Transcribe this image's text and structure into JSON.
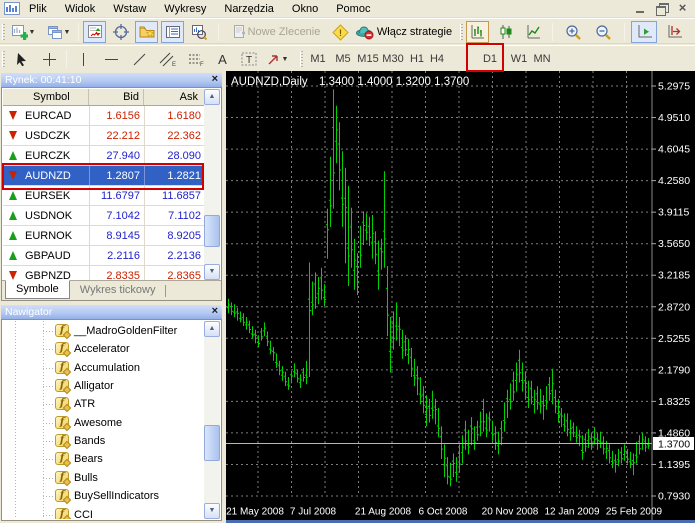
{
  "menu": {
    "items": [
      "Plik",
      "Widok",
      "Wstaw",
      "Wykresy",
      "Narzędzia",
      "Okno",
      "Pomoc"
    ]
  },
  "toolbar": {
    "new_order_label": "Nowe Zlecenie",
    "experts_label": "Włącz strategie",
    "periods": [
      "M1",
      "M5",
      "M15",
      "M30",
      "H1",
      "H4",
      "D1",
      "W1",
      "MN"
    ],
    "highlighted_period": "D1"
  },
  "market_watch": {
    "title": "Rynek: 00:41:10",
    "columns": [
      "Symbol",
      "Bid",
      "Ask"
    ],
    "rows": [
      {
        "symbol": "EURCAD",
        "bid": "1.6156",
        "ask": "1.6180",
        "direction": "down"
      },
      {
        "symbol": "USDCZK",
        "bid": "22.212",
        "ask": "22.362",
        "direction": "down"
      },
      {
        "symbol": "EURCZK",
        "bid": "27.940",
        "ask": "28.090",
        "direction": "up"
      },
      {
        "symbol": "AUDNZD",
        "bid": "1.2807",
        "ask": "1.2821",
        "direction": "down",
        "selected": true
      },
      {
        "symbol": "EURSEK",
        "bid": "11.6797",
        "ask": "11.6857",
        "direction": "up"
      },
      {
        "symbol": "USDNOK",
        "bid": "7.1042",
        "ask": "7.1102",
        "direction": "up"
      },
      {
        "symbol": "EURNOK",
        "bid": "8.9145",
        "ask": "8.9205",
        "direction": "up"
      },
      {
        "symbol": "GBPAUD",
        "bid": "2.2116",
        "ask": "2.2136",
        "direction": "up"
      },
      {
        "symbol": "GBPNZD",
        "bid": "2.8335",
        "ask": "2.8365",
        "direction": "down"
      }
    ],
    "tabs": [
      {
        "label": "Symbole",
        "active": true
      },
      {
        "label": "Wykres tickowy",
        "active": false
      }
    ]
  },
  "navigator": {
    "title": "Nawigator",
    "items": [
      "__MadroGoldenFilter",
      "Accelerator",
      "Accumulation",
      "Alligator",
      "ATR",
      "Awesome",
      "Bands",
      "Bears",
      "Bulls",
      "BuySellIndicators",
      "CCI"
    ]
  },
  "chart_data": {
    "type": "bar",
    "title": "AUDNZD,Daily",
    "ohlc_text": "1.3400 1.4000 1.3200 1.3700",
    "open": 1.34,
    "high": 1.4,
    "low": 1.32,
    "close": 1.37,
    "current_price": 1.37,
    "current_price_label": "1.3700",
    "price_ticks": [
      5.2975,
      4.951,
      4.6045,
      4.258,
      3.9115,
      3.565,
      3.2185,
      2.872,
      2.5255,
      2.179,
      1.8325,
      1.486,
      1.1395,
      0.793
    ],
    "x_ticks": [
      "21 May 2008",
      "7 Jul 2008",
      "21 Aug 2008",
      "6 Oct 2008",
      "20 Nov 2008",
      "12 Jan 2009",
      "25 Feb 2009"
    ],
    "ylim": [
      0.72,
      5.45
    ],
    "grid": true,
    "bar_color": "#00d200",
    "background": "#000000",
    "bars_low_high": [
      [
        2.8,
        2.96
      ],
      [
        2.78,
        2.92
      ],
      [
        2.76,
        2.9
      ],
      [
        2.72,
        2.86
      ],
      [
        2.7,
        2.82
      ],
      [
        2.66,
        2.8
      ],
      [
        2.62,
        2.76
      ],
      [
        2.58,
        2.72
      ],
      [
        2.52,
        2.66
      ],
      [
        2.47,
        2.62
      ],
      [
        2.43,
        2.56
      ],
      [
        2.5,
        2.64
      ],
      [
        2.55,
        2.7
      ],
      [
        2.44,
        2.6
      ],
      [
        2.35,
        2.5
      ],
      [
        2.28,
        2.43
      ],
      [
        2.2,
        2.36
      ],
      [
        2.12,
        2.28
      ],
      [
        2.06,
        2.22
      ],
      [
        2.0,
        2.16
      ],
      [
        1.96,
        2.1
      ],
      [
        2.03,
        2.17
      ],
      [
        2.1,
        2.25
      ],
      [
        2.04,
        2.18
      ],
      [
        1.98,
        2.13
      ],
      [
        2.05,
        2.2
      ],
      [
        2.02,
        2.28
      ],
      [
        2.1,
        3.36
      ],
      [
        2.78,
        3.15
      ],
      [
        2.85,
        3.25
      ],
      [
        2.9,
        3.2
      ],
      [
        2.95,
        3.3
      ],
      [
        2.88,
        3.12
      ],
      [
        3.4,
        3.95
      ],
      [
        3.75,
        4.52
      ],
      [
        3.95,
        5.26
      ],
      [
        4.45,
        5.08
      ],
      [
        4.15,
        4.9
      ],
      [
        3.75,
        4.58
      ],
      [
        3.35,
        4.4
      ],
      [
        3.1,
        4.2
      ],
      [
        3.3,
        3.96
      ],
      [
        3.06,
        3.62
      ],
      [
        3.0,
        3.46
      ],
      [
        3.3,
        3.76
      ],
      [
        3.55,
        3.92
      ],
      [
        3.6,
        3.9
      ],
      [
        3.54,
        3.86
      ],
      [
        3.4,
        3.88
      ],
      [
        3.34,
        3.7
      ],
      [
        3.06,
        3.6
      ],
      [
        3.28,
        3.62
      ],
      [
        3.3,
        4.36
      ],
      [
        2.55,
        3.32
      ],
      [
        2.15,
        2.76
      ],
      [
        2.4,
        2.82
      ],
      [
        2.5,
        2.92
      ],
      [
        2.44,
        2.76
      ],
      [
        2.3,
        2.62
      ],
      [
        2.33,
        2.56
      ],
      [
        2.24,
        2.52
      ],
      [
        2.1,
        2.42
      ],
      [
        2.0,
        2.3
      ],
      [
        1.9,
        2.22
      ],
      [
        1.8,
        2.1
      ],
      [
        1.7,
        2.0
      ],
      [
        1.56,
        1.9
      ],
      [
        1.6,
        1.86
      ],
      [
        1.64,
        1.95
      ],
      [
        1.58,
        1.86
      ],
      [
        1.44,
        1.76
      ],
      [
        1.2,
        1.56
      ],
      [
        1.0,
        1.36
      ],
      [
        0.92,
        1.22
      ],
      [
        0.9,
        1.16
      ],
      [
        1.0,
        1.26
      ],
      [
        0.95,
        1.22
      ],
      [
        1.05,
        1.36
      ],
      [
        1.15,
        1.46
      ],
      [
        1.3,
        1.62
      ],
      [
        1.25,
        1.52
      ],
      [
        1.35,
        1.66
      ],
      [
        1.3,
        1.56
      ],
      [
        1.4,
        1.62
      ],
      [
        1.45,
        1.72
      ],
      [
        1.5,
        1.86
      ],
      [
        1.44,
        1.7
      ],
      [
        1.5,
        1.72
      ],
      [
        1.4,
        1.62
      ],
      [
        1.3,
        1.56
      ],
      [
        1.25,
        1.5
      ],
      [
        1.35,
        1.62
      ],
      [
        1.5,
        1.82
      ],
      [
        1.65,
        1.96
      ],
      [
        1.74,
        2.03
      ],
      [
        1.84,
        2.16
      ],
      [
        1.94,
        2.26
      ],
      [
        2.04,
        2.4
      ],
      [
        1.94,
        2.26
      ],
      [
        1.85,
        2.16
      ],
      [
        1.76,
        2.06
      ],
      [
        1.8,
        2.06
      ],
      [
        1.7,
        1.96
      ],
      [
        1.74,
        2.0
      ],
      [
        1.7,
        1.97
      ],
      [
        1.63,
        1.9
      ],
      [
        1.74,
        2.0
      ],
      [
        1.84,
        2.1
      ],
      [
        1.8,
        2.19
      ],
      [
        1.7,
        1.96
      ],
      [
        1.6,
        1.86
      ],
      [
        1.55,
        1.76
      ],
      [
        1.5,
        1.7
      ],
      [
        1.45,
        1.7
      ],
      [
        1.4,
        1.63
      ],
      [
        1.44,
        1.6
      ],
      [
        1.38,
        1.56
      ],
      [
        1.34,
        1.52
      ],
      [
        1.19,
        1.46
      ],
      [
        1.28,
        1.48
      ],
      [
        1.32,
        1.53
      ],
      [
        1.3,
        1.48
      ],
      [
        1.36,
        1.55
      ],
      [
        1.3,
        1.48
      ],
      [
        1.32,
        1.5
      ],
      [
        1.25,
        1.45
      ],
      [
        1.2,
        1.4
      ],
      [
        1.15,
        1.36
      ],
      [
        1.1,
        1.29
      ],
      [
        1.05,
        1.25
      ],
      [
        1.12,
        1.31
      ],
      [
        1.15,
        1.33
      ],
      [
        1.18,
        1.36
      ],
      [
        1.15,
        1.31
      ],
      [
        1.1,
        1.28
      ],
      [
        1.02,
        1.26
      ],
      [
        1.15,
        1.39
      ],
      [
        1.25,
        1.46
      ],
      [
        1.3,
        1.49
      ],
      [
        1.28,
        1.45
      ],
      [
        1.31,
        1.43
      ]
    ]
  }
}
